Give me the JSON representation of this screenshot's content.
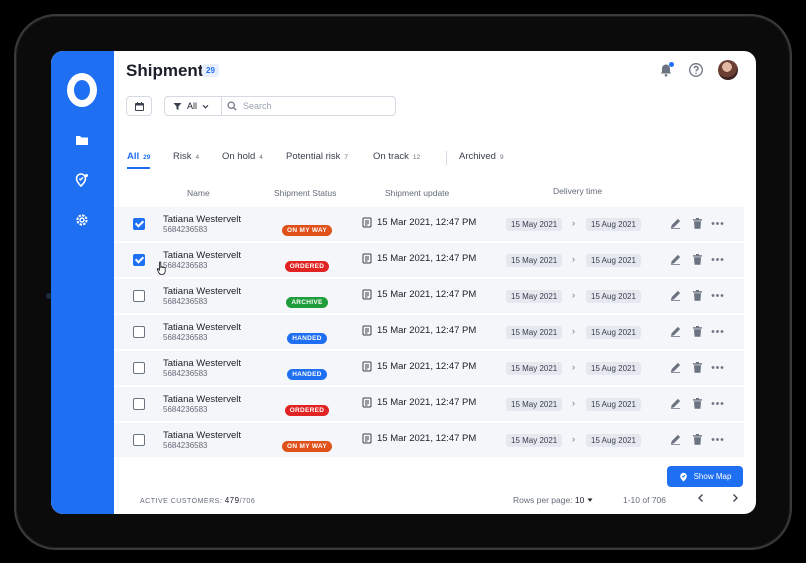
{
  "header": {
    "title": "Shipment",
    "count": "29"
  },
  "toolbar": {
    "filter_value": "All",
    "search_placeholder": "Search"
  },
  "tabs": [
    {
      "label": "All",
      "count": "29",
      "active": true
    },
    {
      "label": "Risk",
      "count": "4"
    },
    {
      "label": "On hold",
      "count": "4"
    },
    {
      "label": "Potential risk",
      "count": "7"
    },
    {
      "label": "On track",
      "count": "12"
    },
    {
      "label": "Archived",
      "count": "9"
    }
  ],
  "table": {
    "columns": [
      "Name",
      "Shipment Status",
      "Shipment update",
      "Delivery time"
    ],
    "rows": [
      {
        "name": "Tatiana Westervelt",
        "number": "5684236583",
        "status": "ON MY WAY",
        "status_color": "#e0521a",
        "update": "15 Mar 2021, 12:47 PM",
        "from": "15 May 2021",
        "to": "15 Aug 2021",
        "checked": true
      },
      {
        "name": "Tatiana Westervelt",
        "number": "5684236583",
        "status": "ORDERED",
        "status_color": "#e02424",
        "update": "15 Mar 2021, 12:47 PM",
        "from": "15 May 2021",
        "to": "15 Aug 2021",
        "checked": true
      },
      {
        "name": "Tatiana Westervelt",
        "number": "5684236583",
        "status": "ARCHIVE",
        "status_color": "#1f9d3a",
        "update": "15 Mar 2021, 12:47 PM",
        "from": "15 May 2021",
        "to": "15 Aug 2021",
        "checked": false
      },
      {
        "name": "Tatiana Westervelt",
        "number": "5684236583",
        "status": "HANDED",
        "status_color": "#1f6ff2",
        "update": "15 Mar 2021, 12:47 PM",
        "from": "15 May 2021",
        "to": "15 Aug 2021",
        "checked": false
      },
      {
        "name": "Tatiana Westervelt",
        "number": "5684236583",
        "status": "HANDED",
        "status_color": "#1f6ff2",
        "update": "15 Mar 2021, 12:47 PM",
        "from": "15 May 2021",
        "to": "15 Aug 2021",
        "checked": false
      },
      {
        "name": "Tatiana Westervelt",
        "number": "5684236583",
        "status": "ORDERED",
        "status_color": "#e02424",
        "update": "15 Mar 2021, 12:47 PM",
        "from": "15 May 2021",
        "to": "15 Aug 2021",
        "checked": false
      },
      {
        "name": "Tatiana Westervelt",
        "number": "5684236583",
        "status": "ON MY WAY",
        "status_color": "#e0521a",
        "update": "15 Mar 2021, 12:47 PM",
        "from": "15 May 2021",
        "to": "15 Aug 2021",
        "checked": false
      }
    ]
  },
  "footer": {
    "show_map": "Show Map",
    "active_label": "ACTIVE CUSTOMERS:",
    "active_value": "479",
    "active_total": "/706",
    "rows_per_page_label": "Rows per page:",
    "rows_per_page_value": "10",
    "range": "1-10 of 706"
  },
  "colors": {
    "accent": "#1f6ff2"
  },
  "icons": [
    "folder-icon",
    "location-icon",
    "gear-icon",
    "notification-icon",
    "help-icon",
    "calendar-icon",
    "filter-icon",
    "search-icon",
    "document-icon",
    "edit-icon",
    "trash-icon",
    "more-icon",
    "map-pin-icon"
  ]
}
